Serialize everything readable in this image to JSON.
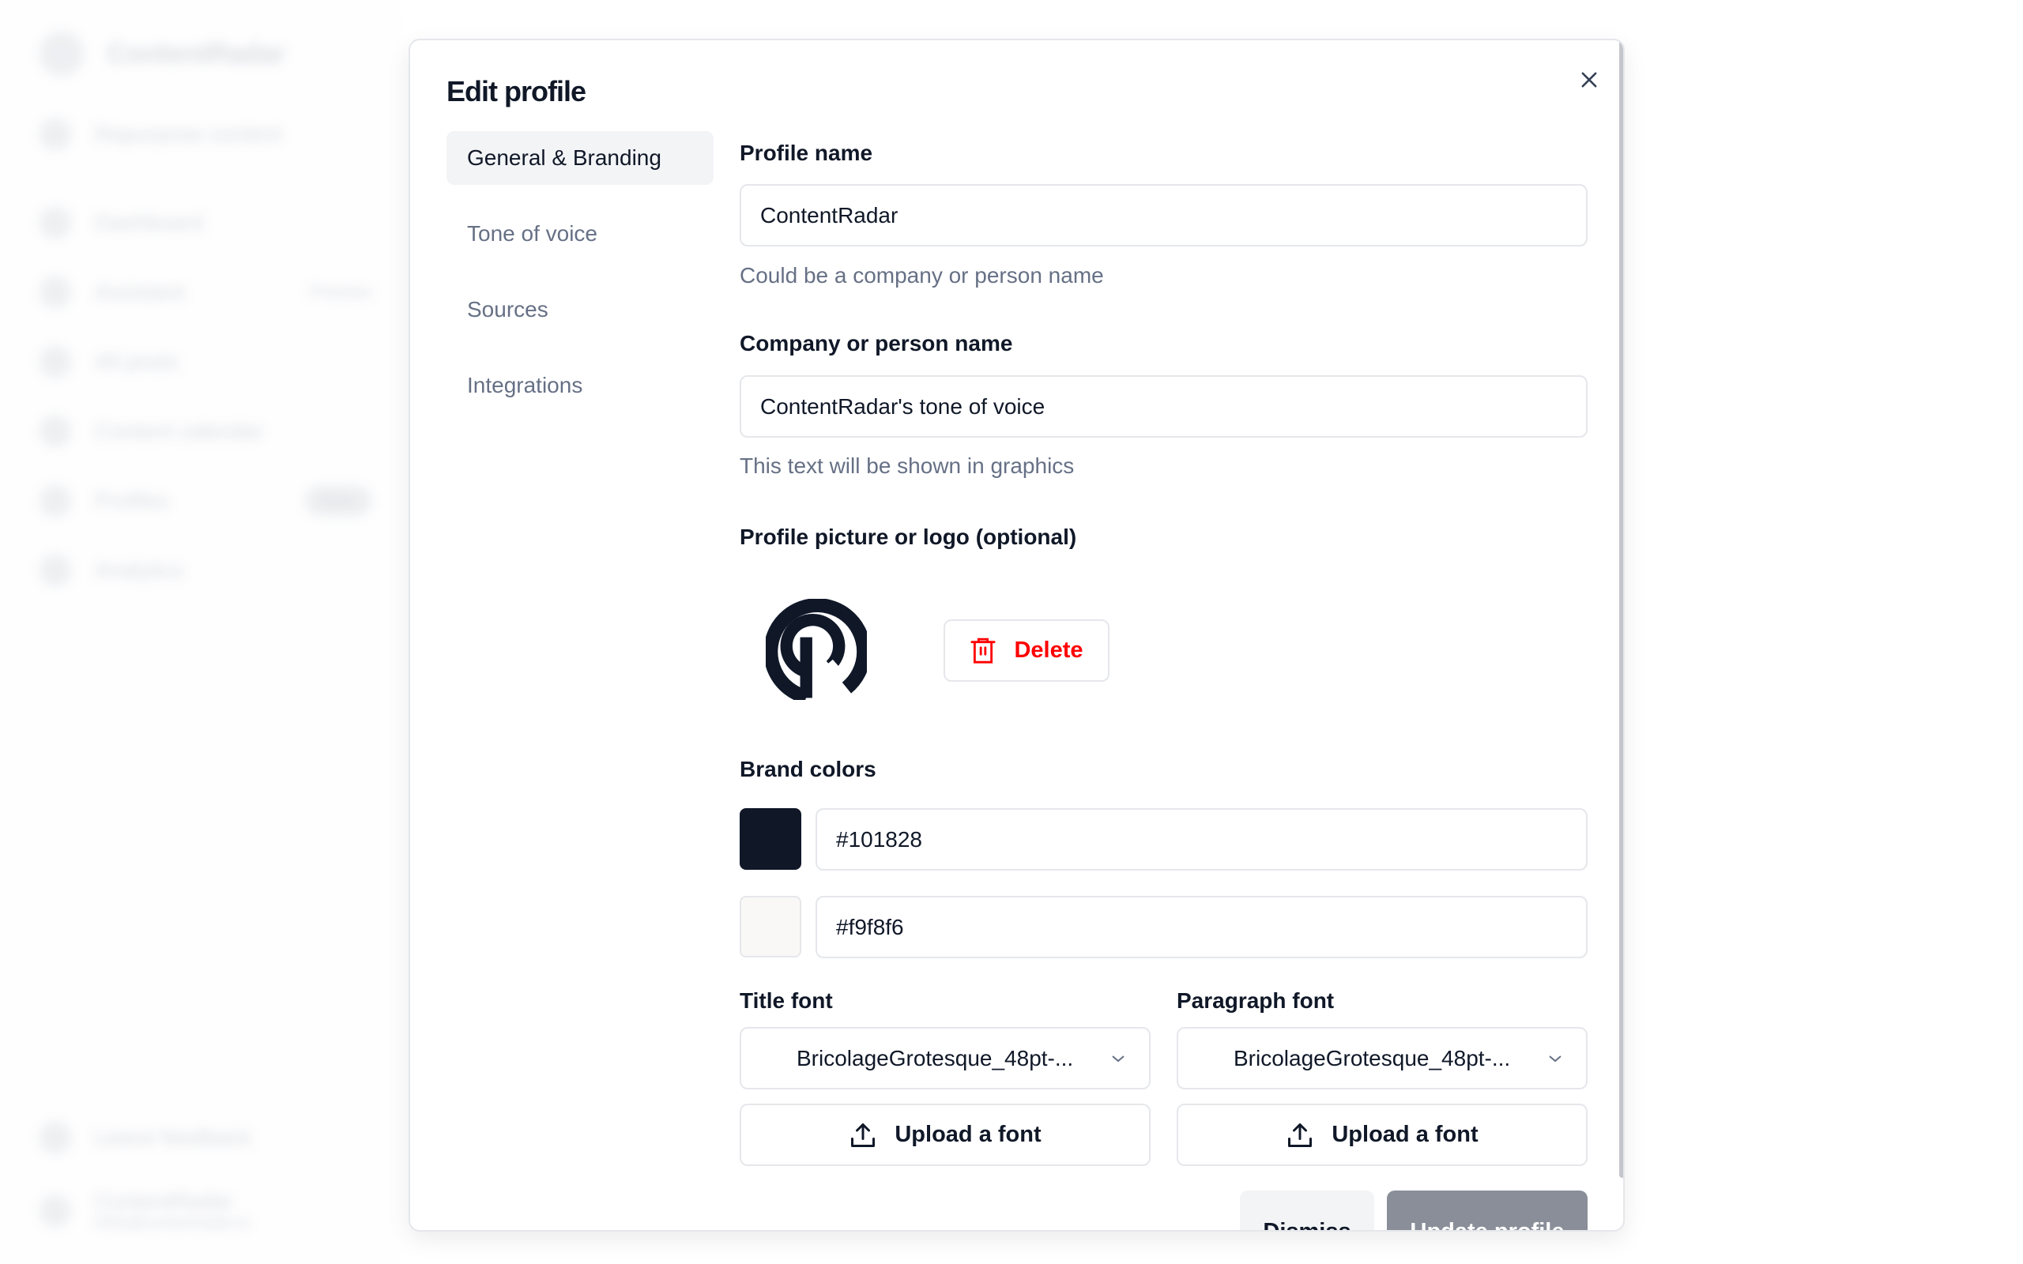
{
  "sidebar": {
    "brand": "ContentRadar",
    "cta": "Repurpose content",
    "items": [
      {
        "label": "Dashboard"
      },
      {
        "label": "Assistant",
        "badge": "Preview"
      },
      {
        "label": "All posts"
      },
      {
        "label": "Content calendar"
      },
      {
        "label": "Profiles",
        "badge": "New"
      },
      {
        "label": "Analytics"
      }
    ],
    "feedback": "Leave feedback",
    "account_name": "ContentRadar",
    "account_email": "hello@contentradar.ai"
  },
  "modal": {
    "title": "Edit profile",
    "nav": [
      {
        "label": "General & Branding",
        "active": true
      },
      {
        "label": "Tone of voice"
      },
      {
        "label": "Sources"
      },
      {
        "label": "Integrations"
      }
    ],
    "profile_name": {
      "label": "Profile name",
      "value": "ContentRadar",
      "help": "Could be a company or person name"
    },
    "company_name": {
      "label": "Company or person name",
      "value": "ContentRadar's tone of voice",
      "help": "This text will be shown in graphics"
    },
    "picture": {
      "label": "Profile picture or logo (optional)",
      "delete_label": "Delete",
      "delete_color": "#ff0000"
    },
    "brand_colors": {
      "label": "Brand colors",
      "colors": [
        "#101828",
        "#f9f8f6"
      ]
    },
    "title_font": {
      "label": "Title font",
      "value": "BricolageGrotesque_48pt-...",
      "upload_label": "Upload a font"
    },
    "paragraph_font": {
      "label": "Paragraph font",
      "value": "BricolageGrotesque_48pt-...",
      "upload_label": "Upload a font"
    },
    "dismiss_label": "Dismiss",
    "update_label": "Update profile"
  }
}
